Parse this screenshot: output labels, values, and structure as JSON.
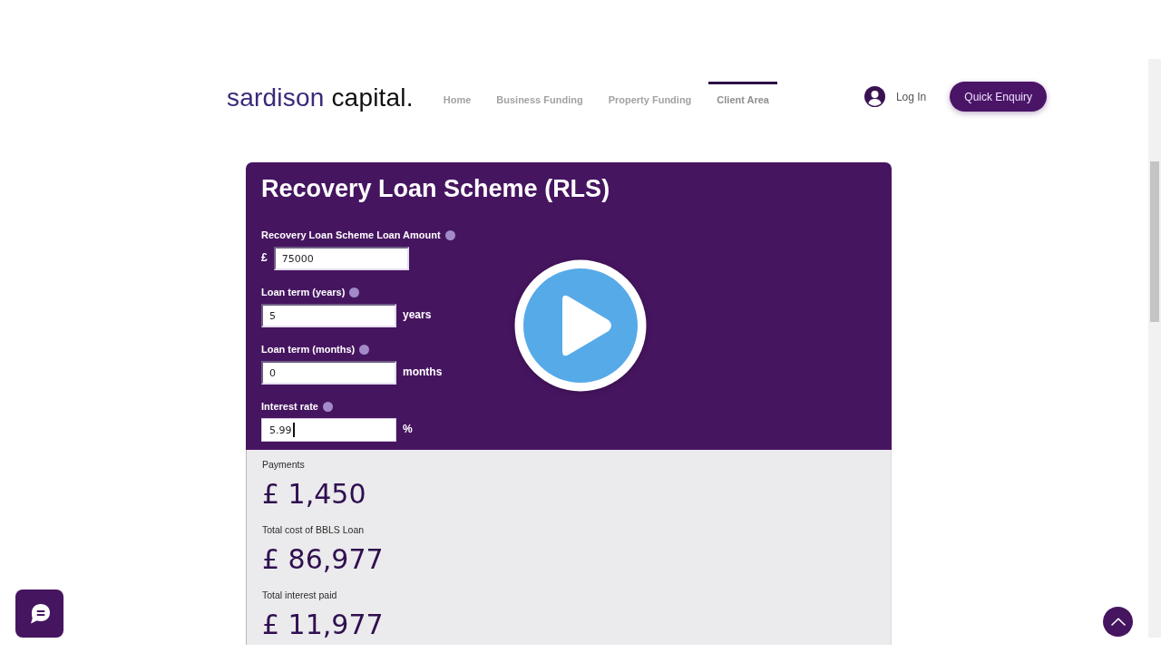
{
  "header": {
    "logo": {
      "name": "sardison",
      "suffix": "capital."
    },
    "nav": [
      {
        "label": "Home",
        "selected": false
      },
      {
        "label": "Business Funding",
        "selected": false
      },
      {
        "label": "Property Funding",
        "selected": false
      },
      {
        "label": "Client Area",
        "selected": true
      }
    ],
    "login": "Log In",
    "quick_enquiry": "Quick Enquiry"
  },
  "calculator": {
    "title": "Recovery Loan Scheme (RLS)",
    "fields": [
      {
        "label": "Recovery Loan Scheme Loan Amount",
        "prefix": "£",
        "value": "75000",
        "focused": false
      },
      {
        "label": "Loan term (years)",
        "value": "5",
        "suffix": "years",
        "focused": false
      },
      {
        "label": "Loan term (months)",
        "value": "0",
        "suffix": "months",
        "focused": false
      },
      {
        "label": "Interest rate",
        "value": "5.99",
        "suffix": "%",
        "focused": true
      }
    ],
    "results": [
      {
        "label": "Payments",
        "value": "£ 1,450"
      },
      {
        "label": "Total cost of BBLS Loan",
        "value": "£ 86,977"
      },
      {
        "label": "Total interest paid",
        "value": "£ 11,977"
      }
    ]
  }
}
